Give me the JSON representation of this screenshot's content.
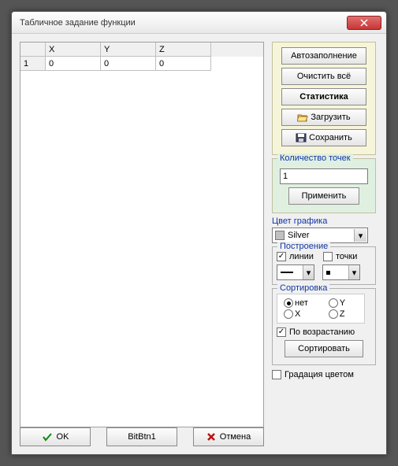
{
  "window": {
    "title": "Табличное задание функции"
  },
  "grid": {
    "headers": {
      "x": "X",
      "y": "Y",
      "z": "Z"
    },
    "rows": [
      {
        "n": "1",
        "x": "0",
        "y": "0",
        "z": "0"
      }
    ]
  },
  "buttons": {
    "autofill": "Автозаполнение",
    "clear": "Очистить всё",
    "stats": "Статистика",
    "load": "Загрузить",
    "save": "Сохранить",
    "apply": "Применить",
    "sort": "Сортировать",
    "ok": "OK",
    "bitbtn": "BitBtn1",
    "cancel": "Отмена"
  },
  "groups": {
    "points_count": "Количество точек",
    "graph_color": "Цвет графика",
    "construction": "Построение",
    "sorting": "Сортировка"
  },
  "points": {
    "value": "1"
  },
  "color": {
    "selected": "Silver",
    "hex": "#c0c0c0"
  },
  "construction": {
    "lines": "линии",
    "points": "точки",
    "lines_on": true,
    "points_on": false
  },
  "sorting": {
    "none": "нет",
    "x": "X",
    "y": "Y",
    "z": "Z",
    "selected": "none",
    "ascending_label": "По возрастанию",
    "ascending": true
  },
  "gradation": {
    "label": "Градация цветом",
    "on": false
  }
}
